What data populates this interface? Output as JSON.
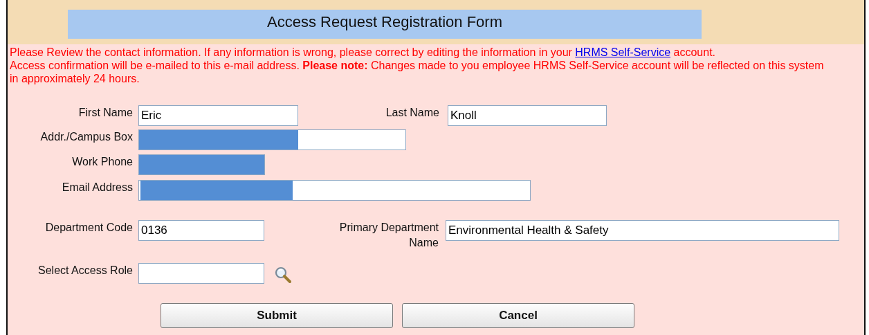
{
  "form": {
    "title": "Access Request Registration Form"
  },
  "notice": {
    "before_link": "Please Review the contact information. If any information is wrong, please correct by editing the information in your ",
    "link": "HRMS Self-Service",
    "after_link": " account.",
    "second": "Access confirmation will be e-mailed to this e-mail address. **Please note:** Changes made to you employee HRMS Self-Service account will be reflected on this system in approximately 24 hours."
  },
  "rows": [
    {
      "fields": [
        {
          "label": "First Name",
          "value": "Eric",
          "redacted": false
        },
        {
          "label": "Last Name",
          "value": "Knoll",
          "redacted": false
        }
      ]
    },
    {
      "fields": [
        {
          "label": "Addr./Campus Box",
          "redacted": true
        }
      ]
    },
    {
      "fields": [
        {
          "label": "Work Phone",
          "redacted": true
        }
      ]
    },
    {
      "fields": [
        {
          "label": "Email Address",
          "redacted": true
        }
      ]
    },
    {
      "fields": [
        {
          "label": "Department Code",
          "value": "0136",
          "redacted": false
        },
        {
          "label": "Primary Department Name",
          "value": "Environmental Health & Safety",
          "redacted": false
        }
      ]
    },
    {
      "fields": [
        {
          "label": "Select Access Role",
          "redacted": false,
          "lookup": true
        }
      ]
    }
  ],
  "buttons": [
    "Submit",
    "Cancel"
  ]
}
